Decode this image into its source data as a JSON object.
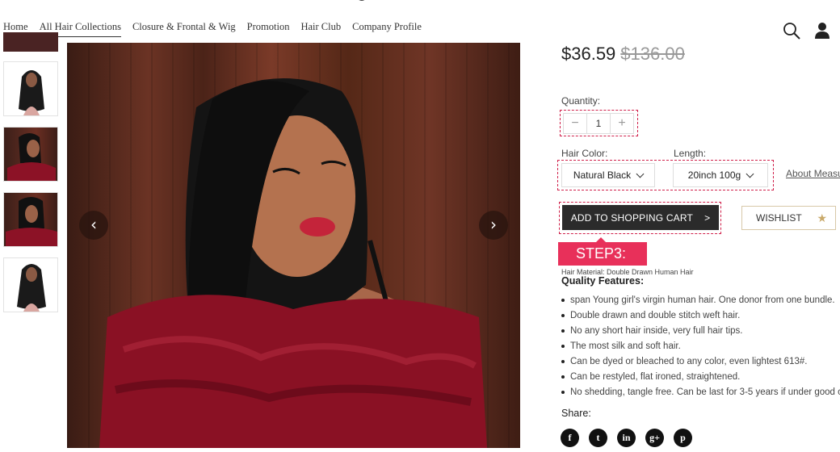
{
  "nav": {
    "items": [
      "Home",
      "All Hair Collections",
      "Closure & Frontal & Wig",
      "Promotion",
      "Hair Club",
      "Company Profile"
    ],
    "active_index": 1
  },
  "icons": {
    "search": "search-icon",
    "user": "user-icon"
  },
  "gallery": {
    "thumbnail_count": 5,
    "prev_label": "‹",
    "next_label": "›"
  },
  "product": {
    "price": "$36.59",
    "old_price": "$136.00",
    "quantity_label": "Quantity:",
    "quantity_value": "1",
    "minus": "−",
    "plus": "+",
    "hair_color_label": "Hair Color:",
    "hair_color_value": "Natural Black",
    "length_label": "Length:",
    "length_value": "20inch 100g",
    "about_link": "About Measu",
    "add_to_cart": "ADD TO SHOPPING CART",
    "add_to_cart_arrow": ">",
    "wishlist": "WISHLIST",
    "step_badge": "STEP3:",
    "material": "Hair Material: Double Drawn Human Hair",
    "quality_title": "Quality Features:",
    "features": [
      "span Young girl's virgin human hair. One donor from one bundle.",
      "Double drawn and double stitch weft hair.",
      "No any short hair inside, very full hair tips.",
      "The most silk and soft hair.",
      "Can be dyed or bleached to any color, even lightest 613#.",
      "Can be restyled, flat ironed, straightened.",
      "No shedding, tangle free. Can be last for 3-5 years if under good c"
    ],
    "share_label": "Share:",
    "socials": [
      "f",
      "t",
      "in",
      "g+",
      "p"
    ]
  },
  "colors": {
    "accent": "#e8305a",
    "cart_bg": "#2b2b2b",
    "wish_border": "#d8c8a8",
    "star": "#c9a96a"
  }
}
